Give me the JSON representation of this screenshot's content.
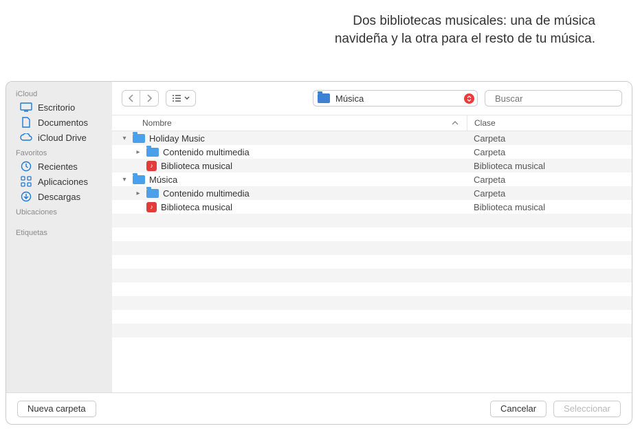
{
  "caption": "Dos bibliotecas musicales: una de música navideña y la otra para el resto de tu música.",
  "sidebar": {
    "sections": [
      {
        "title": "iCloud",
        "items": [
          {
            "icon": "desktop",
            "label": "Escritorio"
          },
          {
            "icon": "doc",
            "label": "Documentos"
          },
          {
            "icon": "cloud",
            "label": "iCloud Drive"
          }
        ]
      },
      {
        "title": "Favoritos",
        "items": [
          {
            "icon": "clock",
            "label": "Recientes"
          },
          {
            "icon": "apps",
            "label": "Aplicaciones"
          },
          {
            "icon": "down",
            "label": "Descargas"
          }
        ]
      },
      {
        "title": "Ubicaciones",
        "items": []
      },
      {
        "title": "Etiquetas",
        "items": []
      }
    ]
  },
  "toolbar": {
    "path_label": "Música",
    "search_placeholder": "Buscar"
  },
  "columns": {
    "name": "Nombre",
    "kind": "Clase"
  },
  "rows": [
    {
      "indent": 0,
      "disclosure": "down",
      "icon": "folder",
      "name": "Holiday Music",
      "kind": "Carpeta"
    },
    {
      "indent": 1,
      "disclosure": "right",
      "icon": "folder",
      "name": "Contenido multimedia",
      "kind": "Carpeta"
    },
    {
      "indent": 1,
      "disclosure": "",
      "icon": "lib",
      "name": "Biblioteca musical",
      "kind": "Biblioteca musical"
    },
    {
      "indent": 0,
      "disclosure": "down",
      "icon": "folder",
      "name": "Música",
      "kind": "Carpeta"
    },
    {
      "indent": 1,
      "disclosure": "right",
      "icon": "folder",
      "name": "Contenido multimedia",
      "kind": "Carpeta"
    },
    {
      "indent": 1,
      "disclosure": "",
      "icon": "lib",
      "name": "Biblioteca musical",
      "kind": "Biblioteca musical"
    }
  ],
  "footer": {
    "new_folder": "Nueva carpeta",
    "cancel": "Cancelar",
    "select": "Seleccionar"
  }
}
